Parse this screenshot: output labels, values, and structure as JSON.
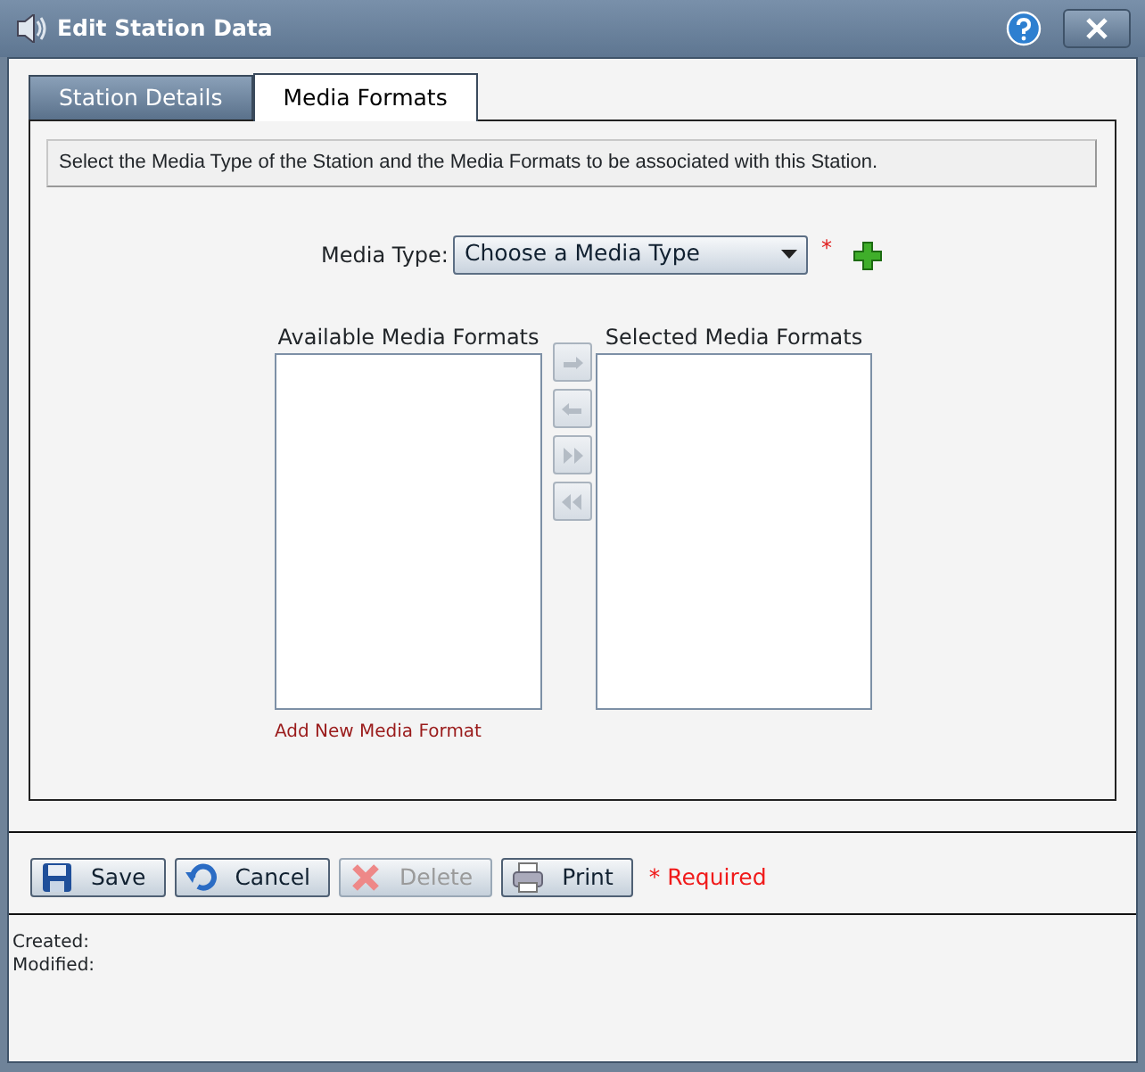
{
  "window": {
    "title": "Edit Station Data"
  },
  "tabs": [
    {
      "label": "Station Details",
      "selected": false
    },
    {
      "label": "Media Formats",
      "selected": true
    }
  ],
  "instruction": "Select the Media Type of the Station and the Media Formats to be associated with this Station.",
  "media_type": {
    "label": "Media Type:",
    "value": "Choose a Media Type",
    "required_mark": "*"
  },
  "available_list": {
    "heading": "Available Media Formats"
  },
  "selected_list": {
    "heading": "Selected Media Formats"
  },
  "move_buttons": [
    {
      "kind": "right",
      "disabled": true
    },
    {
      "kind": "left",
      "disabled": true
    },
    {
      "kind": "all-right",
      "disabled": true
    },
    {
      "kind": "all-left",
      "disabled": true
    }
  ],
  "add_link": "Add New Media Format",
  "buttons": [
    {
      "kind": "save",
      "label": "Save",
      "disabled": false
    },
    {
      "kind": "cancel",
      "label": "Cancel",
      "disabled": false
    },
    {
      "kind": "delete",
      "label": "Delete",
      "disabled": true
    },
    {
      "kind": "print",
      "label": "Print",
      "disabled": false
    }
  ],
  "required_note": "* Required",
  "audit": [
    "Created:",
    "Modified:"
  ]
}
